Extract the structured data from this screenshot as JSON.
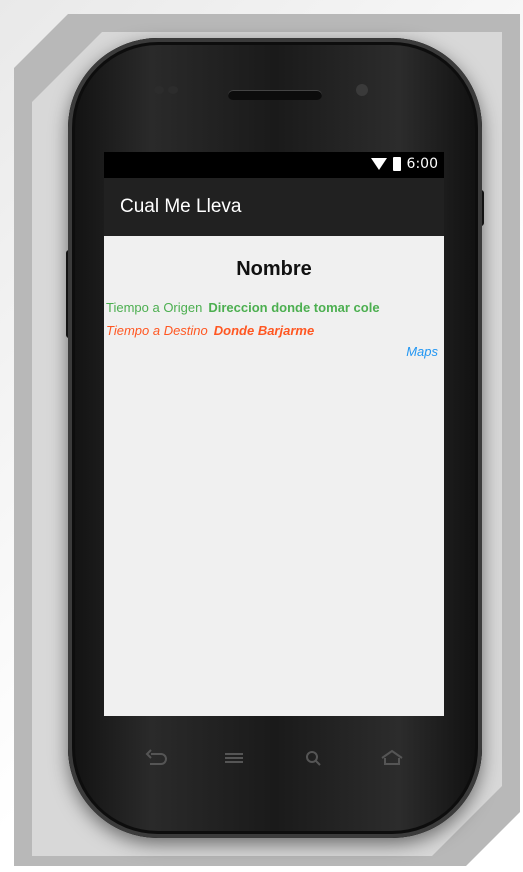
{
  "device": {
    "status_time": "6:00"
  },
  "app": {
    "title": "Cual Me Lleva"
  },
  "content": {
    "name": "Nombre",
    "origin_label": "Tiempo a Origen",
    "origin_value": "Direccion donde tomar cole",
    "destination_label": "Tiempo a Destino",
    "destination_value": "Donde Barjarme",
    "maps_link": "Maps"
  },
  "colors": {
    "origin": "#4caf50",
    "destination": "#ff5722",
    "link": "#2196f3",
    "actionbar": "#212121",
    "screen_bg": "#f0f0f0"
  },
  "icons": {
    "nav": [
      "back-icon",
      "menu-icon",
      "search-icon",
      "home-icon"
    ],
    "status": [
      "wifi-icon",
      "battery-icon"
    ]
  }
}
